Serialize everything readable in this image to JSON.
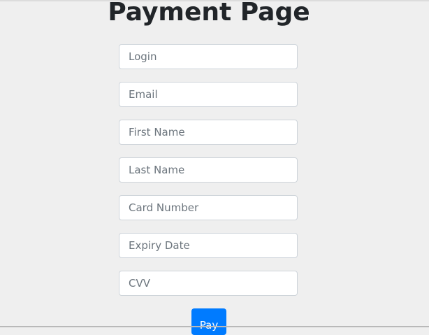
{
  "page": {
    "title": "Payment Page"
  },
  "form": {
    "fields": [
      {
        "name": "login",
        "placeholder": "Login",
        "value": ""
      },
      {
        "name": "email",
        "placeholder": "Email",
        "value": ""
      },
      {
        "name": "first_name",
        "placeholder": "First Name",
        "value": ""
      },
      {
        "name": "last_name",
        "placeholder": "Last Name",
        "value": ""
      },
      {
        "name": "card_number",
        "placeholder": "Card Number",
        "value": ""
      },
      {
        "name": "expiry_date",
        "placeholder": "Expiry Date",
        "value": ""
      },
      {
        "name": "cvv",
        "placeholder": "CVV",
        "value": ""
      }
    ],
    "submit_label": "Pay"
  },
  "colors": {
    "background": "#efefef",
    "primary_button": "#007bff",
    "title_text": "#212529",
    "field_border": "#ced4da"
  }
}
